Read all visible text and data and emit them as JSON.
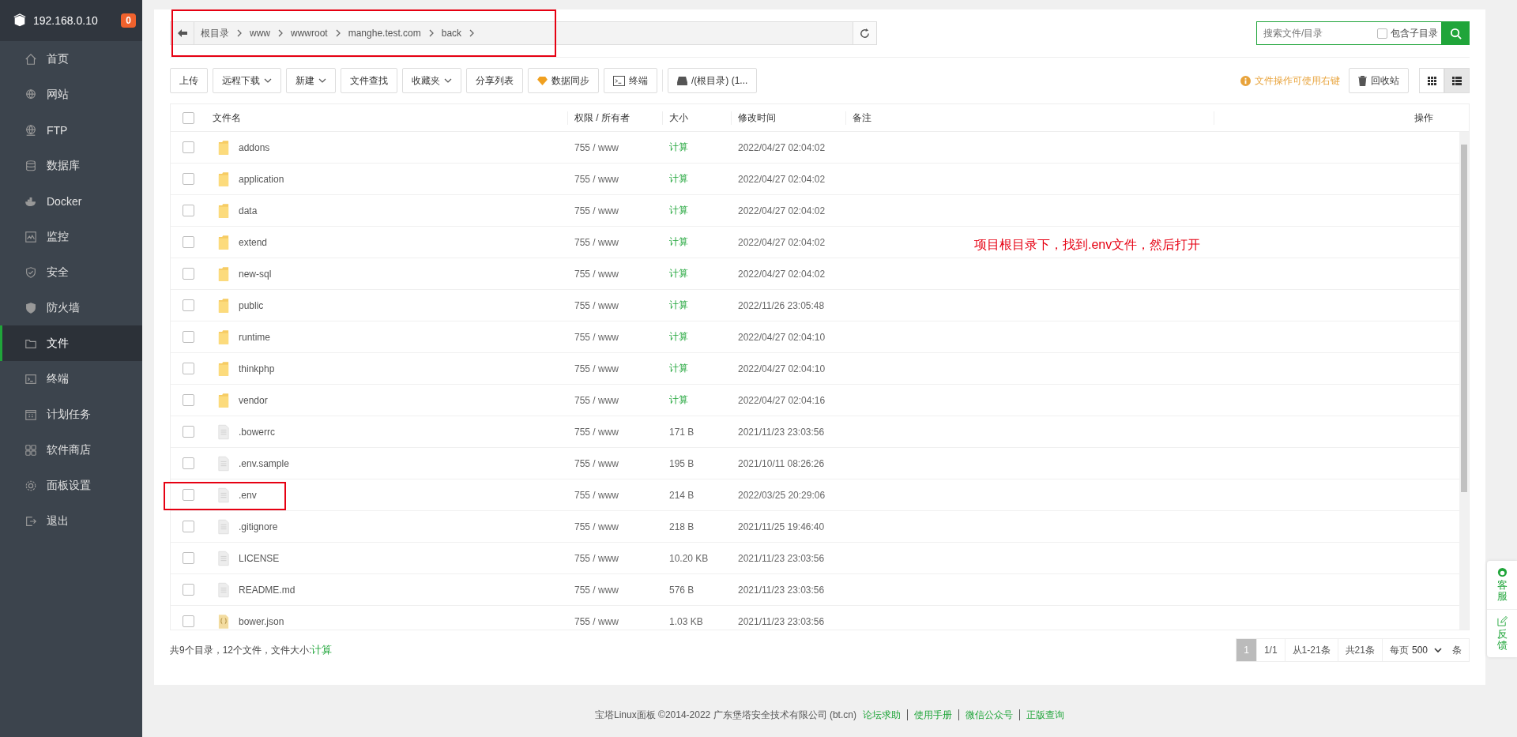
{
  "sidebar": {
    "host": "192.168.0.10",
    "badge": "0",
    "items": [
      {
        "label": "首页",
        "selected": false
      },
      {
        "label": "网站",
        "selected": false
      },
      {
        "label": "FTP",
        "selected": false
      },
      {
        "label": "数据库",
        "selected": false
      },
      {
        "label": "Docker",
        "selected": false
      },
      {
        "label": "监控",
        "selected": false
      },
      {
        "label": "安全",
        "selected": false
      },
      {
        "label": "防火墙",
        "selected": false
      },
      {
        "label": "文件",
        "selected": true
      },
      {
        "label": "终端",
        "selected": false
      },
      {
        "label": "计划任务",
        "selected": false
      },
      {
        "label": "软件商店",
        "selected": false
      },
      {
        "label": "面板设置",
        "selected": false
      },
      {
        "label": "退出",
        "selected": false
      }
    ]
  },
  "breadcrumb": [
    "根目录",
    "www",
    "wwwroot",
    "manghe.test.com",
    "back"
  ],
  "search": {
    "placeholder": "搜索文件/目录",
    "include_sub": {
      "label": "包含子目录",
      "checked": false
    }
  },
  "toolbar": [
    {
      "label": "上传",
      "kind": "plain"
    },
    {
      "label": "远程下载",
      "kind": "dropdown"
    },
    {
      "label": "新建",
      "kind": "dropdown"
    },
    {
      "label": "文件查找",
      "kind": "plain"
    },
    {
      "label": "收藏夹",
      "kind": "dropdown"
    },
    {
      "label": "分享列表",
      "kind": "plain"
    },
    {
      "label": "数据同步",
      "kind": "sync"
    },
    {
      "label": "终端",
      "kind": "terminal"
    },
    {
      "label": "/(根目录) (1...",
      "kind": "disk"
    }
  ],
  "tip": "文件操作可使用右键",
  "recycle": "回收站",
  "views": [
    {
      "kind": "grid",
      "selected": false
    },
    {
      "kind": "list",
      "selected": true
    }
  ],
  "select_all": {
    "checked": false
  },
  "columns": [
    "文件名",
    "权限 / 所有者",
    "大小",
    "修改时间",
    "备注",
    "操作"
  ],
  "rows": [
    {
      "kind": "folder",
      "checked": false,
      "name": "addons",
      "perm": "755 / www",
      "size": "计算",
      "time": "2022/04/27 02:04:02"
    },
    {
      "kind": "folder",
      "checked": false,
      "name": "application",
      "perm": "755 / www",
      "size": "计算",
      "time": "2022/04/27 02:04:02"
    },
    {
      "kind": "folder",
      "checked": false,
      "name": "data",
      "perm": "755 / www",
      "size": "计算",
      "time": "2022/04/27 02:04:02"
    },
    {
      "kind": "folder",
      "checked": false,
      "name": "extend",
      "perm": "755 / www",
      "size": "计算",
      "time": "2022/04/27 02:04:02"
    },
    {
      "kind": "folder",
      "checked": false,
      "name": "new-sql",
      "perm": "755 / www",
      "size": "计算",
      "time": "2022/04/27 02:04:02"
    },
    {
      "kind": "folder",
      "checked": false,
      "name": "public",
      "perm": "755 / www",
      "size": "计算",
      "time": "2022/11/26 23:05:48"
    },
    {
      "kind": "folder",
      "checked": false,
      "name": "runtime",
      "perm": "755 / www",
      "size": "计算",
      "time": "2022/04/27 02:04:10"
    },
    {
      "kind": "folder",
      "checked": false,
      "name": "thinkphp",
      "perm": "755 / www",
      "size": "计算",
      "time": "2022/04/27 02:04:10"
    },
    {
      "kind": "folder",
      "checked": false,
      "name": "vendor",
      "perm": "755 / www",
      "size": "计算",
      "time": "2022/04/27 02:04:16"
    },
    {
      "kind": "file",
      "checked": false,
      "name": ".bowerrc",
      "perm": "755 / www",
      "size": "171 B",
      "time": "2021/11/23 23:03:56"
    },
    {
      "kind": "file",
      "checked": false,
      "name": ".env.sample",
      "perm": "755 / www",
      "size": "195 B",
      "time": "2021/10/11 08:26:26"
    },
    {
      "kind": "file",
      "checked": false,
      "name": ".env",
      "perm": "755 / www",
      "size": "214 B",
      "time": "2022/03/25 20:29:06"
    },
    {
      "kind": "file",
      "checked": false,
      "name": ".gitignore",
      "perm": "755 / www",
      "size": "218 B",
      "time": "2021/11/25 19:46:40"
    },
    {
      "kind": "file",
      "checked": false,
      "name": "LICENSE",
      "perm": "755 / www",
      "size": "10.20 KB",
      "time": "2021/11/23 23:03:56"
    },
    {
      "kind": "file",
      "checked": false,
      "name": "README.md",
      "perm": "755 / www",
      "size": "576 B",
      "time": "2021/11/23 23:03:56"
    },
    {
      "kind": "json",
      "checked": false,
      "name": "bower.json",
      "perm": "755 / www",
      "size": "1.03 KB",
      "time": "2021/11/23 23:03:56"
    }
  ],
  "summary": {
    "text": "共9个目录，12个文件，文件大小:",
    "link": "计算"
  },
  "pagination": {
    "current": "1",
    "pages": "1/1",
    "range": "从1-21条",
    "total": "共21条",
    "per_page_label": "每页",
    "per_page": "500",
    "unit": "条"
  },
  "side_tabs": [
    "客服",
    "反馈"
  ],
  "annotation": "项目根目录下，找到.env文件，然后打开",
  "footer": {
    "text": "宝塔Linux面板 ©2014-2022 广东堡塔安全技术有限公司 (bt.cn)",
    "links": [
      "论坛求助",
      "使用手册",
      "微信公众号",
      "正版查询"
    ]
  }
}
